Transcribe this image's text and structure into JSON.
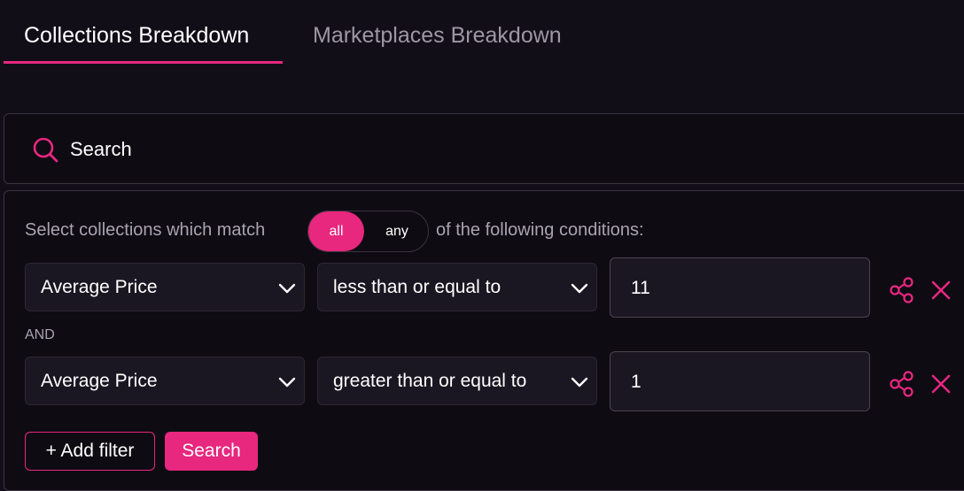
{
  "tabs": [
    {
      "label": "Collections Breakdown",
      "active": true
    },
    {
      "label": "Marketplaces Breakdown",
      "active": false
    }
  ],
  "search": {
    "label": "Search",
    "icon": "search-icon"
  },
  "filter": {
    "match_prefix": "Select collections which match",
    "match_suffix": "of the following conditions:",
    "match_options": [
      "all",
      "any"
    ],
    "match_selected": "all",
    "conjunction": "AND",
    "conditions": [
      {
        "field": "Average Price",
        "operator": "less than or equal to",
        "value": "11"
      },
      {
        "field": "Average Price",
        "operator": "greater than or equal to",
        "value": "1"
      }
    ],
    "add_filter_label": "+ Add filter",
    "search_button_label": "Search"
  },
  "colors": {
    "accent": "#e8277f",
    "background": "#120e18",
    "panel": "#0e0b13",
    "field": "#1b1722",
    "muted_text": "#a9a4b0"
  }
}
